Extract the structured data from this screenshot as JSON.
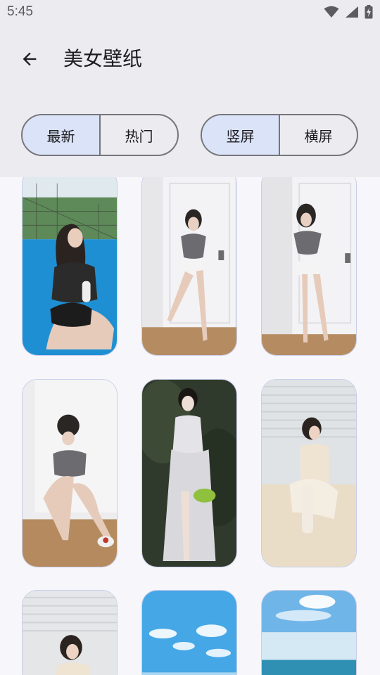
{
  "status_bar": {
    "time": "5:45",
    "icons": [
      "wifi-icon",
      "signal-icon",
      "battery-charging-icon"
    ]
  },
  "toolbar": {
    "back_icon": "arrow-back-icon",
    "title": "美女壁纸"
  },
  "filters": {
    "sort": {
      "options": [
        "最新",
        "热门"
      ],
      "selected": "最新"
    },
    "orientation": {
      "options": [
        "竖屏",
        "横屏"
      ],
      "selected": "竖屏"
    }
  },
  "colors": {
    "header_bg": "#ecebf0",
    "page_bg": "#f7f6fb",
    "active_segment": "#dae3f7",
    "outline": "#75757c",
    "card_border": "#c9cdea"
  },
  "wallpapers": [
    {
      "scene": "tennis-court"
    },
    {
      "scene": "white-door"
    },
    {
      "scene": "white-door"
    },
    {
      "scene": "white-wall-floor"
    },
    {
      "scene": "dark-garden"
    },
    {
      "scene": "blinds-sofa"
    },
    {
      "scene": "blinds-window"
    },
    {
      "scene": "blue-sky"
    },
    {
      "scene": "sky-sea"
    }
  ]
}
